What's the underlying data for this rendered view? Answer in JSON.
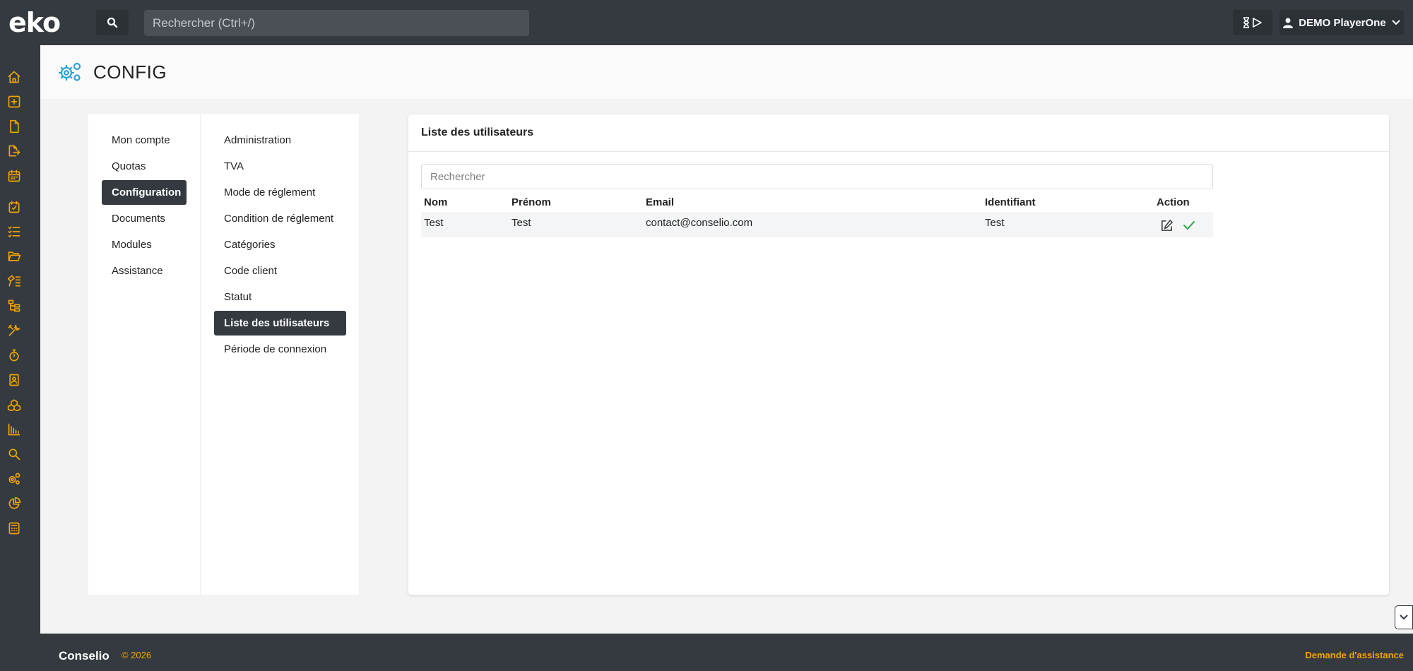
{
  "topbar": {
    "logo_text": "eko",
    "search_placeholder": "Rechercher (Ctrl+/)",
    "timer_icon": "hourglass-play-icon",
    "user_name": "DEMO PlayerOne"
  },
  "sidebar": {
    "icons": [
      "home-icon",
      "plus-square-icon",
      "document-icon",
      "export-document-icon",
      "calendar-icon",
      "calendar-check-icon",
      "list-check-icon",
      "folder-open-icon",
      "tools-list-icon",
      "hierarchy-icon",
      "wrench-icon",
      "stopwatch-icon",
      "contact-book-icon",
      "boxes-icon",
      "bar-chart-icon",
      "search-icon",
      "gears-icon",
      "pie-chart-icon",
      "calculator-icon"
    ],
    "accent_color": "#f0a500"
  },
  "page": {
    "title": "CONFIG",
    "title_icon": "gears-icon",
    "title_icon_color": "#2ba3d6"
  },
  "settings_nav": {
    "column1": [
      {
        "label": "Mon compte",
        "active": false
      },
      {
        "label": "Quotas",
        "active": false
      },
      {
        "label": "Configuration",
        "active": true
      },
      {
        "label": "Documents",
        "active": false
      },
      {
        "label": "Modules",
        "active": false
      },
      {
        "label": "Assistance",
        "active": false
      }
    ],
    "column2": [
      {
        "label": "Administration",
        "active": false
      },
      {
        "label": "TVA",
        "active": false
      },
      {
        "label": "Mode de réglement",
        "active": false
      },
      {
        "label": "Condition de réglement",
        "active": false
      },
      {
        "label": "Catégories",
        "active": false
      },
      {
        "label": "Code client",
        "active": false
      },
      {
        "label": "Statut",
        "active": false
      },
      {
        "label": "Liste des utilisateurs",
        "active": true
      },
      {
        "label": "Période de connexion",
        "active": false
      }
    ]
  },
  "panel": {
    "title": "Liste des utilisateurs",
    "search_placeholder": "Rechercher",
    "columns": [
      "Nom",
      "Prénom",
      "Email",
      "Identifiant",
      "Action"
    ],
    "rows": [
      {
        "nom": "Test",
        "prenom": "Test",
        "email": "contact@conselio.com",
        "identifiant": "Test",
        "actions": [
          "edit-icon",
          "check-icon"
        ]
      }
    ]
  },
  "footer": {
    "brand": "Conselio",
    "year": "© 2026",
    "help_link": "Demande d'assistance"
  },
  "colors": {
    "dark": "#343a40",
    "accent": "#f0a500",
    "check_green": "#28a745"
  }
}
